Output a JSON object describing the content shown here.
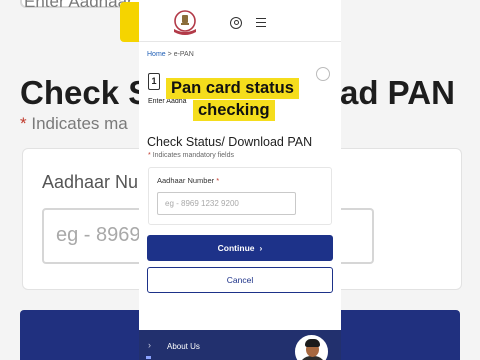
{
  "background": {
    "top_field_text": "Enter Aadhaar",
    "title_left": "Check St",
    "title_right": "ad PAN",
    "mandatory_note": "Indicates ma",
    "aadhaar_label": "Aadhaar Nu",
    "input_placeholder": "eg - 8969"
  },
  "breadcrumb": {
    "home": "Home",
    "separator": ">",
    "current": "e-PAN"
  },
  "stepper": {
    "step_number": "1",
    "step_label": "Enter Aadha"
  },
  "overlay": {
    "line1": "Pan card status",
    "line2": "checking"
  },
  "form": {
    "title": "Check Status/ Download PAN",
    "asterisk": "*",
    "mandatory_note": "Indicates mandatory fields",
    "aadhaar_label": "Aadhaar Number",
    "aadhaar_placeholder": "eg - 8969 1232 9200",
    "aadhaar_value": ""
  },
  "buttons": {
    "continue_label": "Continue",
    "continue_icon": "›",
    "cancel_label": "Cancel"
  },
  "footer": {
    "chevron": "›",
    "about_label": "About Us"
  },
  "colors": {
    "primary": "#1d3289",
    "highlight": "#f5dd1c",
    "required": "#c0392b",
    "link": "#1f5fb6"
  },
  "icons": {
    "header_logo": "india-emblem-icon",
    "account": "user-icon",
    "menu": "hamburger-menu-icon"
  }
}
